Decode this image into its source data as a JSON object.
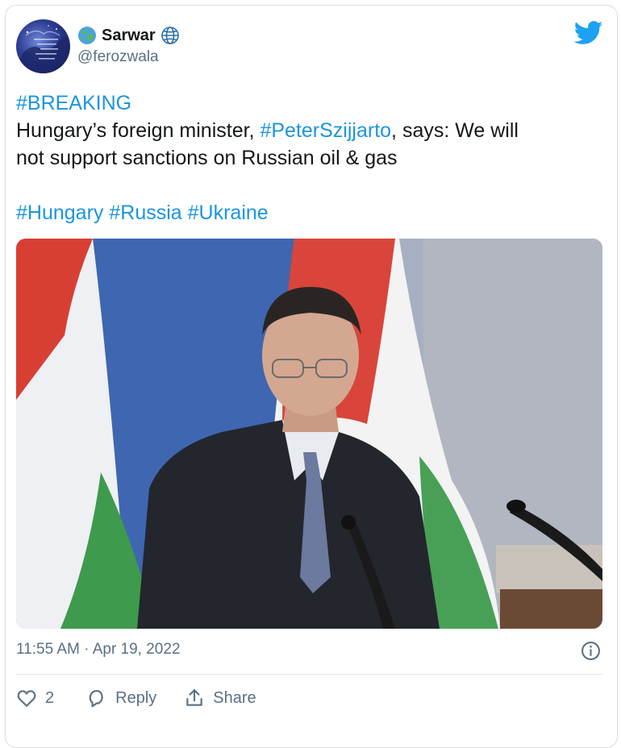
{
  "tweet": {
    "author": {
      "display_name": "Sarwar",
      "handle": "@ferozwala",
      "avatar_icon": "profile-avatar",
      "name_icons": [
        "earth-globe-emoji-icon",
        "globe-outline-icon"
      ]
    },
    "brand_icon": "twitter-bird-icon",
    "text": {
      "line1_hashtag": "#BREAKING",
      "line2_before": "Hungary’s foreign minister, ",
      "line2_hashtag": "#PeterSzijjarto",
      "line2_after": ", says: We will",
      "line3": "not support sanctions on Russian oil & gas",
      "hashtags": [
        "#Hungary",
        "#Russia",
        "#Ukraine"
      ]
    },
    "media": {
      "kind": "photo",
      "subject": "man in dark suit at podium with microphones in front of Hungarian flags"
    },
    "timestamp": "11:55 AM · Apr 19, 2022",
    "info_icon": "info-icon",
    "actions": {
      "like_count": "2",
      "reply_label": "Reply",
      "share_label": "Share"
    },
    "colors": {
      "link": "#1b95e0",
      "twitter_blue": "#1da1f2",
      "secondary_text": "#5b7083"
    }
  }
}
